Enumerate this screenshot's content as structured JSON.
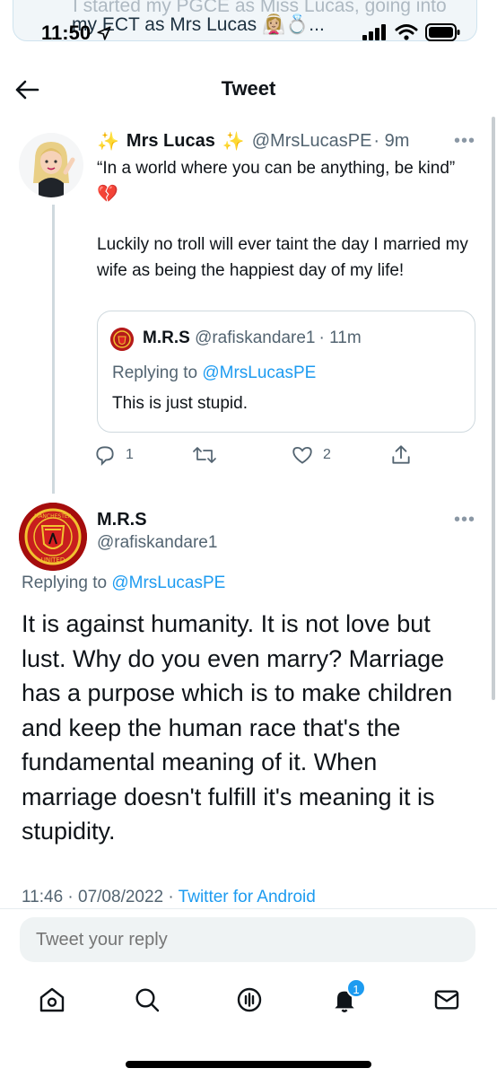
{
  "notification": {
    "line1": "I started my PGCE as Miss Lucas, going into",
    "line2": "my ECT as Mrs Lucas 👰🏼‍♀️💍..."
  },
  "status_bar": {
    "time": "11:50"
  },
  "header": {
    "title": "Tweet"
  },
  "quoted_parent": {
    "name": "Mrs Lucas",
    "sparkle": "✨",
    "handle": "@MrsLucasPE",
    "time": "· 9m",
    "text_line1": "“In a world where you can be anything, be kind” 💔",
    "text_line2": "Luckily no troll will ever taint the day I married my wife as being the happiest day of my life!",
    "quote": {
      "name": "M.R.S",
      "handle": "@rafiskandare1",
      "time": "· 11m",
      "replying_prefix": "Replying to",
      "replying_to": "@MrsLucasPE",
      "text": "This is just stupid."
    },
    "actions": {
      "replies": "1",
      "likes": "2"
    }
  },
  "main_tweet": {
    "name": "M.R.S",
    "handle": "@rafiskandare1",
    "replying_prefix": "Replying to",
    "replying_to": "@MrsLucasPE",
    "text": "It is against humanity. It is not love but lust. Why do you even marry? Marriage has a purpose which is to make children and keep the human race that's the fundamental meaning of it. When marriage doesn't fulfill it's meaning it is stupidity.",
    "timestamp": "11:46 · 07/08/2022 ·",
    "source": "Twitter for Android"
  },
  "reply": {
    "placeholder": "Tweet your reply"
  },
  "bottom_nav": {
    "items": [
      "home-icon",
      "search-icon",
      "spaces-icon",
      "notifications-icon",
      "messages-icon"
    ],
    "notification_count": "1"
  },
  "colors": {
    "accent": "#1d9bf0",
    "text": "#0f1419",
    "muted": "#536471",
    "sparkle": "#f4c430"
  }
}
